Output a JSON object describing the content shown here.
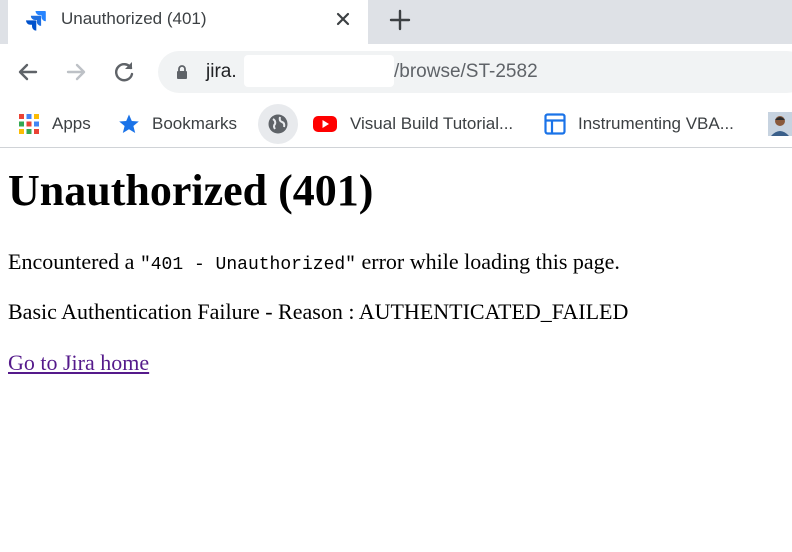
{
  "browser": {
    "tab": {
      "title": "Unauthorized (401)",
      "favicon": "jira-icon"
    },
    "omnibox": {
      "url_host": "jira.",
      "url_path": "/browse/ST-2582"
    },
    "bookmarks": [
      {
        "label": "Apps",
        "icon": "apps-grid-icon"
      },
      {
        "label": "Bookmarks",
        "icon": "star-icon"
      },
      {
        "label": "",
        "icon": "globe-icon"
      },
      {
        "label": "Visual Build Tutorial...",
        "icon": "youtube-icon"
      },
      {
        "label": "Instrumenting VBA...",
        "icon": "doc-icon"
      },
      {
        "label": "",
        "icon": "avatar"
      }
    ]
  },
  "page": {
    "heading": "Unauthorized (401)",
    "message_prefix": "Encountered a ",
    "message_code": "\"401 - Unauthorized\"",
    "message_suffix": " error while loading this page.",
    "reason": "Basic Authentication Failure - Reason : AUTHENTICATED_FAILED",
    "home_link": "Go to Jira home"
  },
  "colors": {
    "link_visited": "#551a8b",
    "tab_strip": "#dee1e6",
    "omnibox": "#f1f3f4",
    "jira_blue": "#2684ff",
    "youtube_red": "#ff0000"
  }
}
